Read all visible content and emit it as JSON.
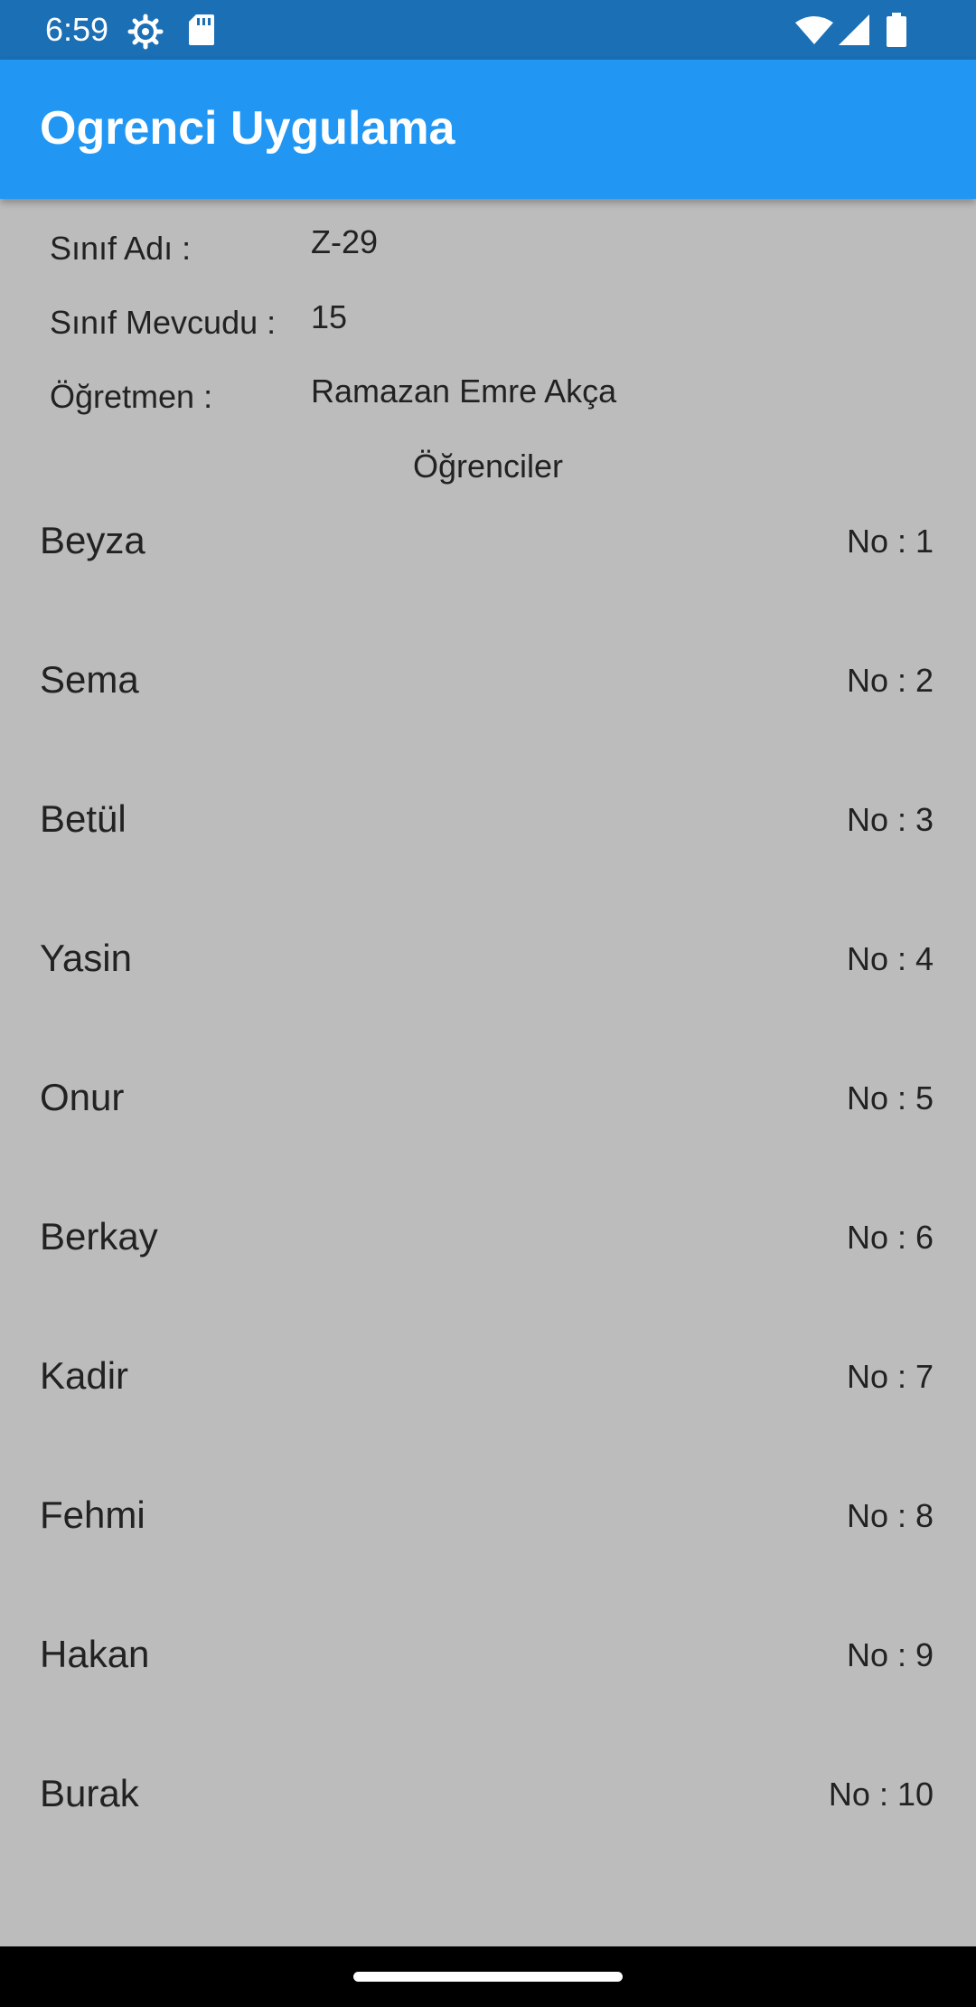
{
  "status_bar": {
    "time": "6:59",
    "icons": [
      "gear-icon",
      "sd-card-icon",
      "wifi-icon",
      "signal-icon",
      "battery-icon"
    ],
    "background_color": "#1a6fb5"
  },
  "app_bar": {
    "title": "Ogrenci Uygulama",
    "background_color": "#2196f3"
  },
  "class_info": {
    "class_name_label": "Sınıf Adı :",
    "class_name_value": "Z-29",
    "class_size_label": "Sınıf Mevcudu :",
    "class_size_value": "15",
    "teacher_label": "Öğretmen :",
    "teacher_value": "Ramazan Emre Akça"
  },
  "students_section": {
    "title": "Öğrenciler",
    "students": [
      {
        "name": "Beyza",
        "number": "No : 1"
      },
      {
        "name": "Sema",
        "number": "No : 2"
      },
      {
        "name": "Betül",
        "number": "No : 3"
      },
      {
        "name": "Yasin",
        "number": "No : 4"
      },
      {
        "name": "Onur",
        "number": "No : 5"
      },
      {
        "name": "Berkay",
        "number": "No : 6"
      },
      {
        "name": "Kadir",
        "number": "No : 7"
      },
      {
        "name": "Fehmi",
        "number": "No : 8"
      },
      {
        "name": "Hakan",
        "number": "No : 9"
      },
      {
        "name": "Burak",
        "number": "No : 10"
      }
    ]
  },
  "page_background_color": "#bcbcbc"
}
